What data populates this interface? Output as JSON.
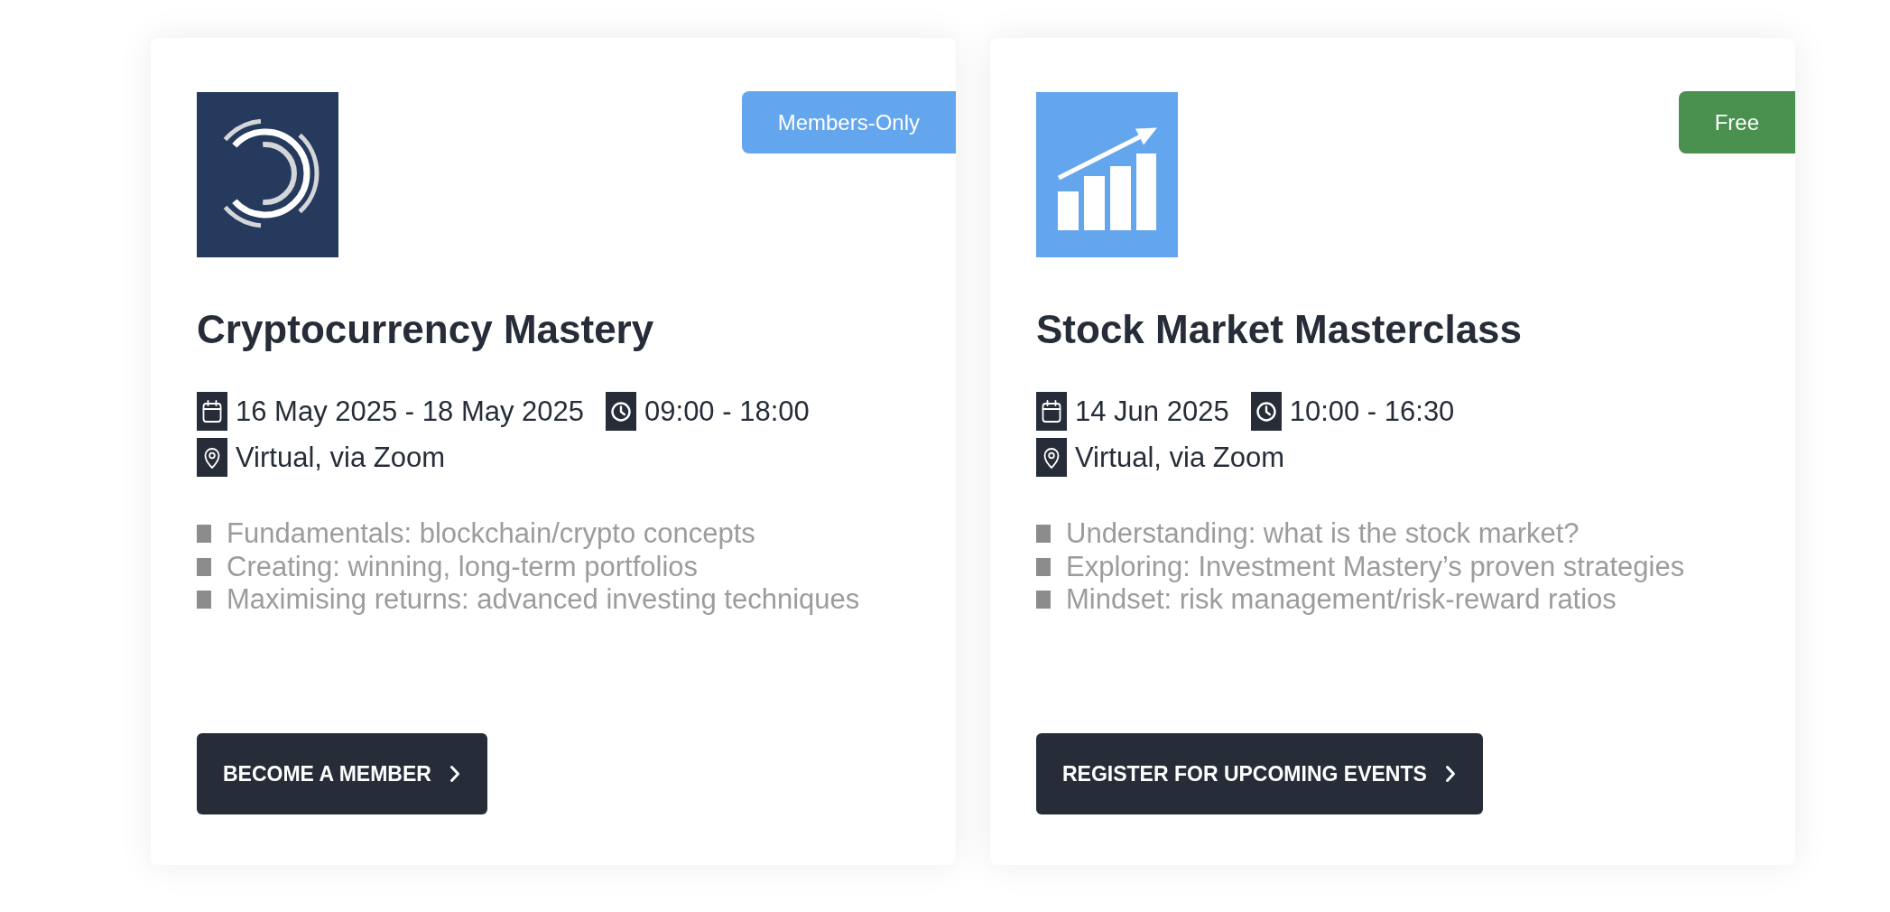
{
  "cards": [
    {
      "logo": {
        "kind": "rings"
      },
      "badge": {
        "label": "Members-Only",
        "color": "#63a6ee"
      },
      "title": "Cryptocurrency Mastery",
      "date": "16 May 2025 - 18 May 2025",
      "time": "09:00 - 18:00",
      "location": "Virtual, via Zoom",
      "highlights": [
        "Fundamentals: blockchain/crypto concepts",
        "Creating: winning, long-term portfolios",
        "Maximising returns: advanced investing techniques"
      ],
      "button": {
        "label": "BECOME A MEMBER"
      }
    },
    {
      "logo": {
        "kind": "chart"
      },
      "badge": {
        "label": "Free",
        "color": "#4a914f"
      },
      "title": "Stock Market Masterclass",
      "date": "14 Jun 2025",
      "time": "10:00 - 16:30",
      "location": "Virtual, via Zoom",
      "highlights": [
        "Understanding: what is the stock market?",
        "Exploring: Investment Mastery’s proven strategies",
        "Mindset: risk management/risk-reward ratios"
      ],
      "button": {
        "label": "REGISTER FOR UPCOMING EVENTS"
      }
    }
  ]
}
